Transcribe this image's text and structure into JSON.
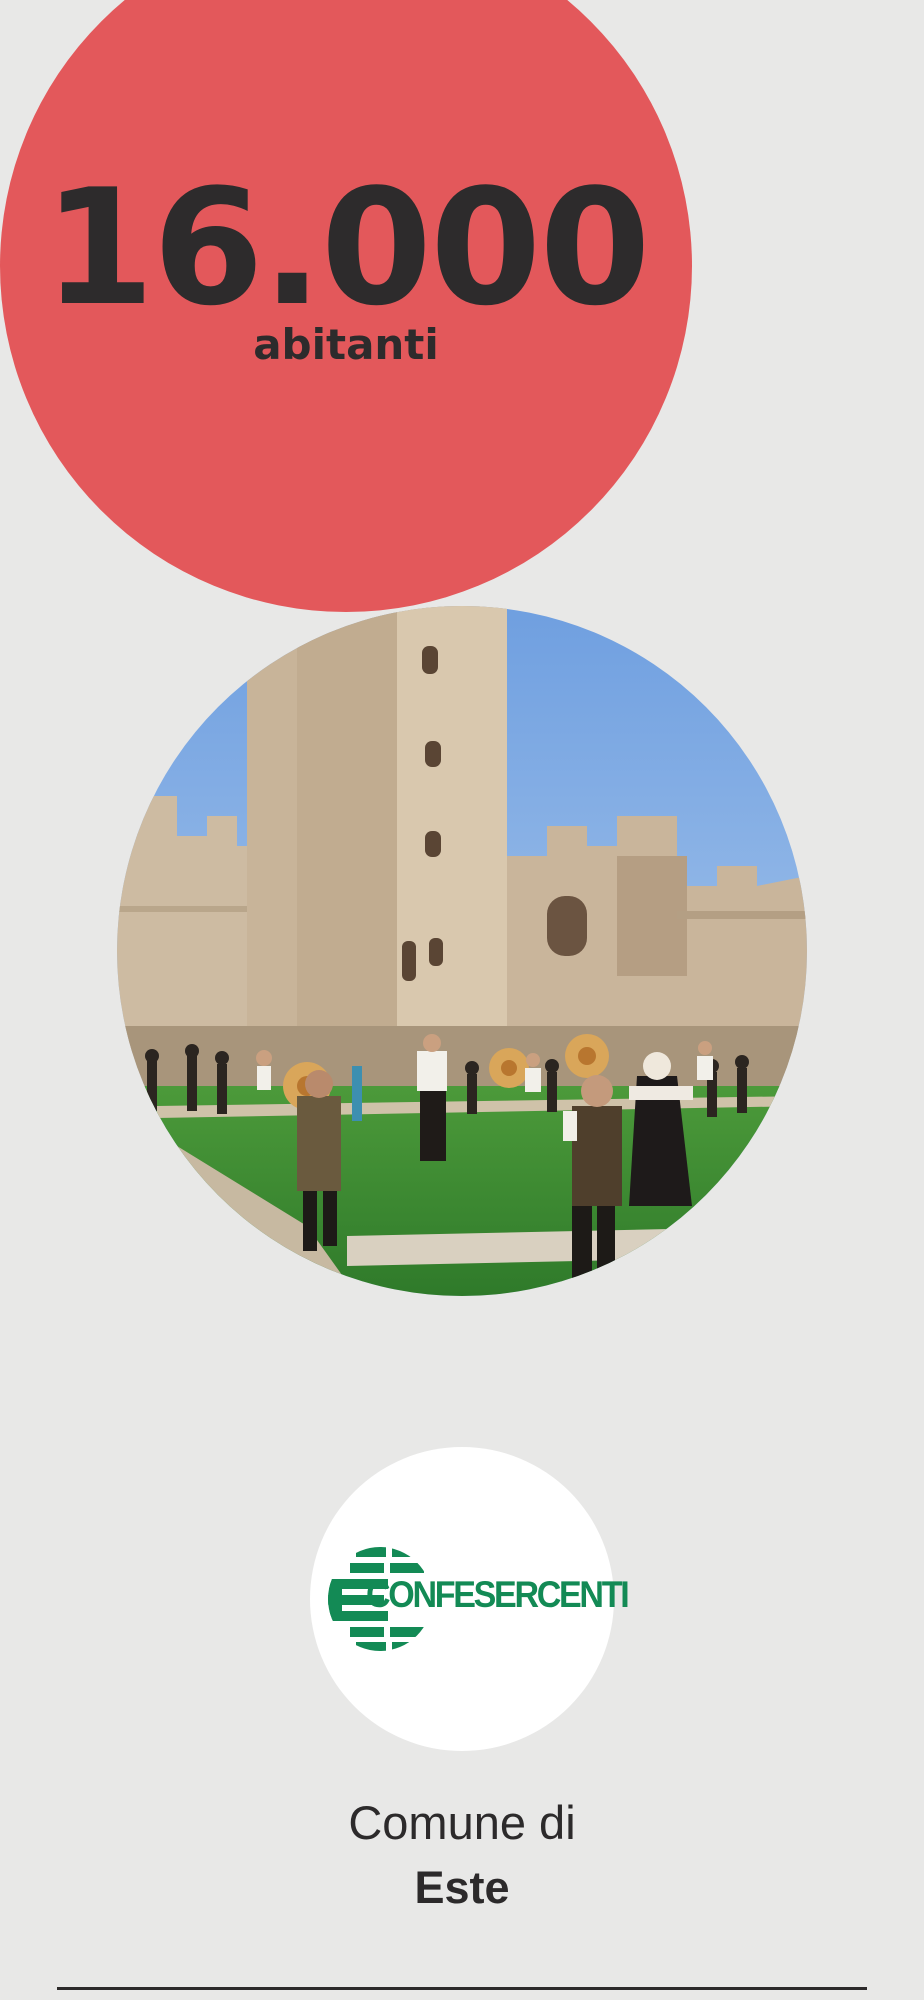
{
  "stat": {
    "value": "16.000",
    "label": "abitanti"
  },
  "photo": {
    "subject": "castle-courtyard-archers"
  },
  "logo": {
    "text": "CONFESERCENTI",
    "icon": "confesercenti-logo-icon",
    "color": "#138a55"
  },
  "comune": {
    "prefix": "Comune di",
    "name": "Este"
  },
  "colors": {
    "background": "#e8e8e7",
    "accent": "#e3585b",
    "text": "#2c2a2b"
  }
}
